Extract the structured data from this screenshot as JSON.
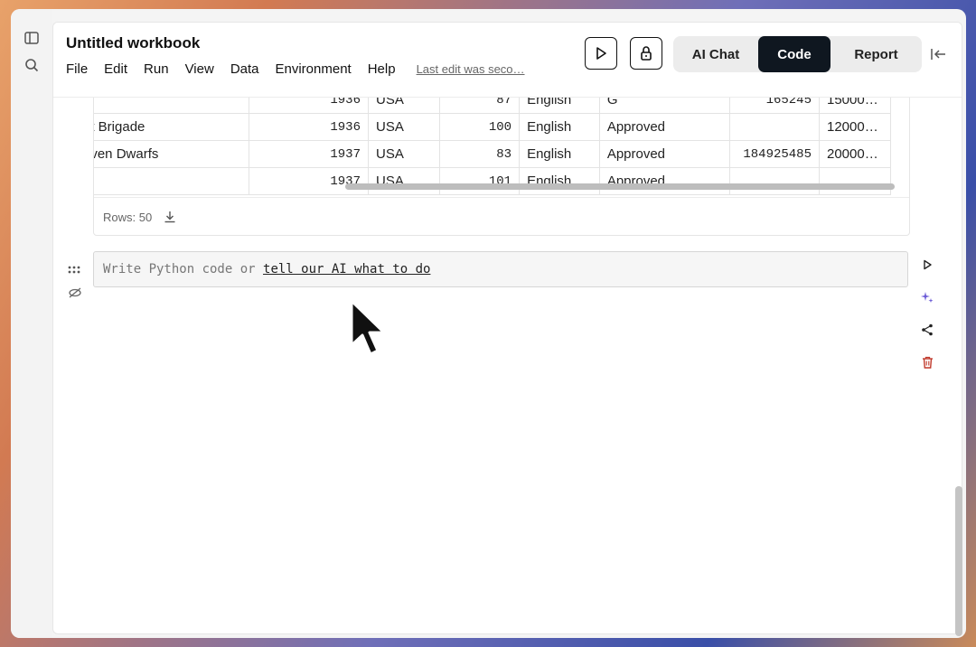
{
  "app": {
    "title": "Untitled workbook",
    "menu": [
      "File",
      "Edit",
      "Run",
      "View",
      "Data",
      "Environment",
      "Help"
    ],
    "last_edit": "Last edit was seco…"
  },
  "toolbar": {
    "run_icon": "play-icon",
    "lock_icon": "lock-icon",
    "modes": [
      {
        "label": "AI Chat",
        "active": false
      },
      {
        "label": "Code",
        "active": true
      },
      {
        "label": "Report",
        "active": false
      }
    ],
    "collapse_icon": "collapse-right-icon"
  },
  "sidebar": {
    "icons": [
      "panel-toggle-icon",
      "search-icon"
    ]
  },
  "table": {
    "rows": [
      [
        "",
        "1936",
        "USA",
        "87",
        "English",
        "G",
        "165245",
        "15000…"
      ],
      [
        "nt Brigade",
        "1936",
        "USA",
        "100",
        "English",
        "Approved",
        "",
        "12000…"
      ],
      [
        "even Dwarfs",
        "1937",
        "USA",
        "83",
        "English",
        "Approved",
        "184925485",
        "20000…"
      ],
      [
        "",
        "1937",
        "USA",
        "101",
        "English",
        "Approved",
        "",
        ""
      ]
    ],
    "rows_label": "Rows: 50",
    "download_icon": "download-icon"
  },
  "cell": {
    "placeholder_prefix": "Write Python code or ",
    "placeholder_link": "tell our AI what to do",
    "actions": [
      "run-cell-icon",
      "ai-sparkle-icon",
      "share-icon",
      "delete-icon"
    ]
  },
  "colors": {
    "accent_dark": "#0f1720",
    "delete_red": "#c0392b",
    "sparkle_purple": "#6b5bd6"
  }
}
